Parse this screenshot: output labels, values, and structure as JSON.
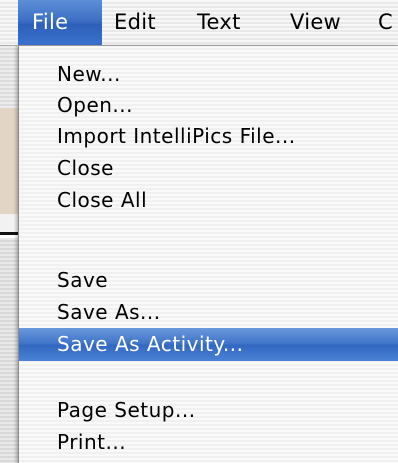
{
  "menubar": {
    "items": [
      {
        "label": "File",
        "active": true
      },
      {
        "label": "Edit"
      },
      {
        "label": "Text"
      },
      {
        "label": "View"
      },
      {
        "label": "C"
      }
    ]
  },
  "file_menu": {
    "items": [
      {
        "label": "New..."
      },
      {
        "label": "Open..."
      },
      {
        "label": "Import IntelliPics File..."
      },
      {
        "label": "Close"
      },
      {
        "label": "Close All"
      },
      {
        "label": "Save"
      },
      {
        "label": "Save As..."
      },
      {
        "label": "Save As Activity...",
        "highlighted": true
      },
      {
        "label": "Page Setup..."
      },
      {
        "label": "Print..."
      }
    ]
  },
  "colors": {
    "highlight": "#3f73c9",
    "menubar_bg": "#f0f0f0",
    "text": "#000000",
    "highlight_text": "#ffffff"
  }
}
